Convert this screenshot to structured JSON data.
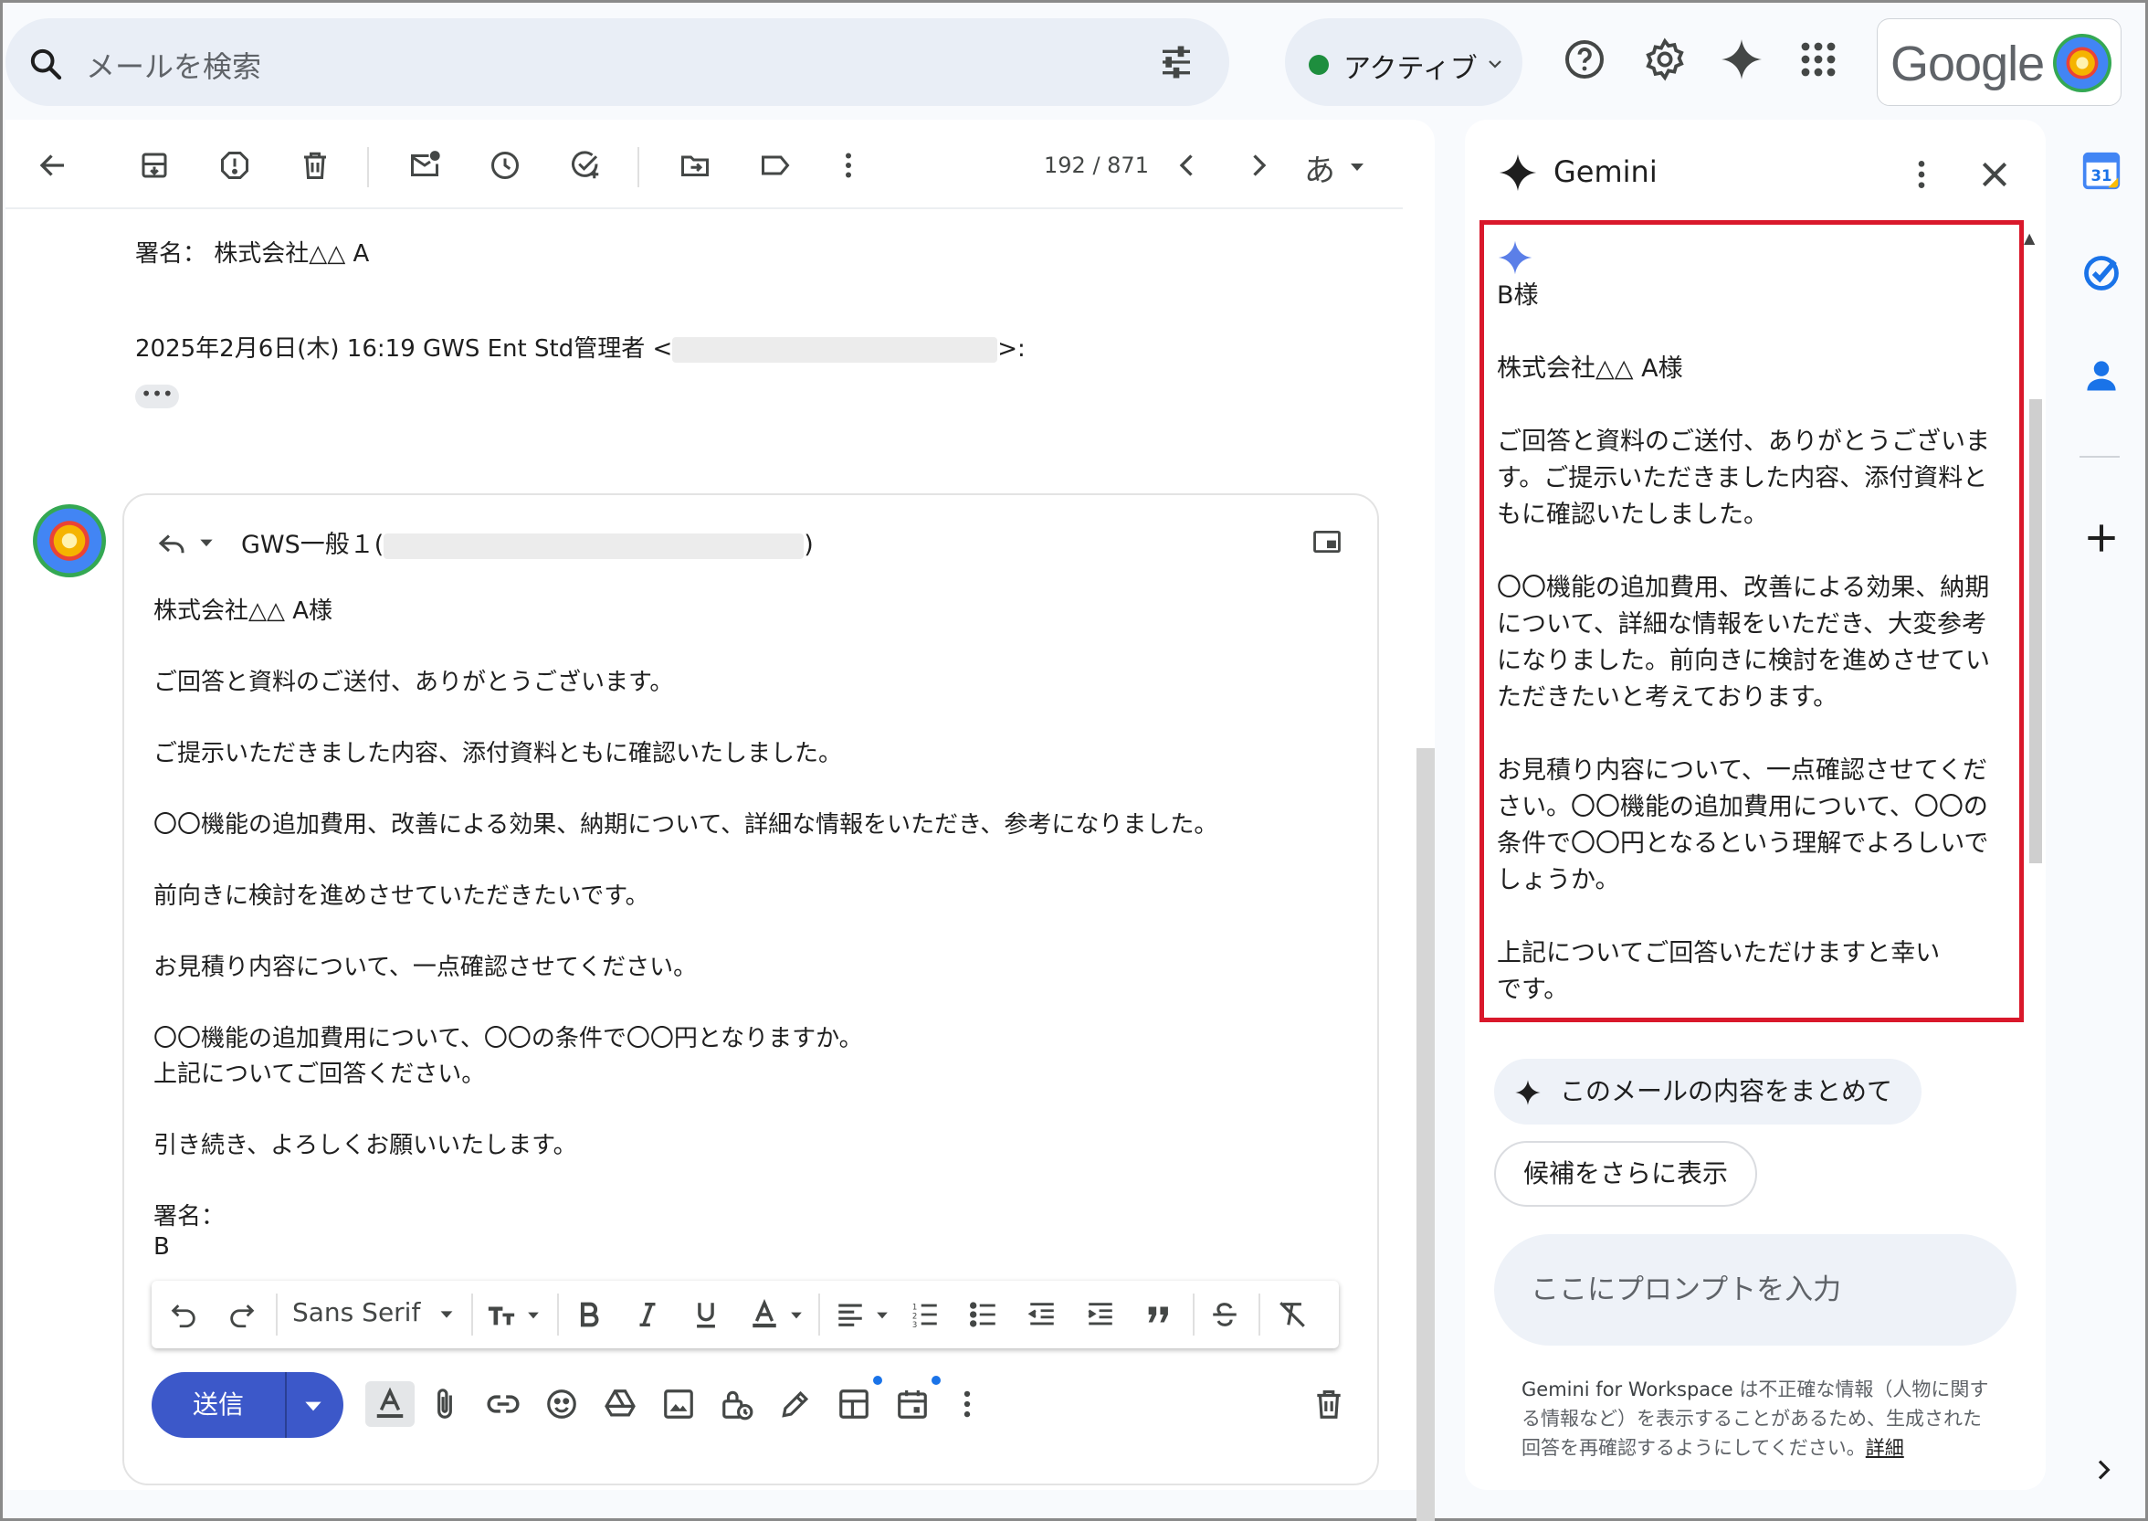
{
  "topbar": {
    "search_placeholder": "メールを検索",
    "status_label": "アクティブ",
    "google_wordmark": "Google"
  },
  "toolbar": {
    "pager": "192 / 871",
    "language": "あ"
  },
  "quoted": {
    "signature": "署名： 株式会社△△ A",
    "header_line_prefix": "2025年2月6日(木) 16:19 GWS Ent Std管理者 <",
    "header_line_suffix": ">:",
    "more": "•••"
  },
  "compose": {
    "to_prefix": "GWS一般１(",
    "to_suffix": ")",
    "body": [
      "株式会社△△ A様",
      "ご回答と資料のご送付、ありがとうございます。",
      "ご提示いただきました内容、添付資料ともに確認いたしました。",
      "〇〇機能の追加費用、改善による効果、納期について、詳細な情報をいただき、参考になりました。",
      "前向きに検討を進めさせていただきたいです。",
      "お見積り内容について、一点確認させてください。",
      "〇〇機能の追加費用について、〇〇の条件で〇〇円となりますか。",
      "上記についてご回答ください。",
      "引き続き、よろしくお願いいたします。",
      "署名：",
      "B"
    ],
    "font_name": "Sans Serif",
    "send_label": "送信"
  },
  "gemini": {
    "title": "Gemini",
    "response_lines": [
      "B様",
      "株式会社△△ A様",
      "ご回答と資料のご送付、ありがとうございま",
      "す。ご提示いただきました内容、添付資料と",
      "もに確認いたしました。",
      "〇〇機能の追加費用、改善による効果、納期",
      "について、詳細な情報をいただき、大変参考",
      "になりました。前向きに検討を進めさせてい",
      "ただきたいと考えております。",
      "お見積り内容について、一点確認させてくだ",
      "さい。〇〇機能の追加費用について、〇〇の",
      "条件で〇〇円となるという理解でよろしいで",
      "しょうか。",
      "上記についてご回答いただけますと幸い",
      "です。"
    ],
    "chip_summary": "このメールの内容をまとめて",
    "chip_more": "候補をさらに表示",
    "prompt_placeholder": "ここにプロンプトを入力",
    "disclaimer_brand": "Gemini for Workspace",
    "disclaimer_text": " は不正確な情報（人物に関する情報など）を表示することがあるため、生成された回答を再確認するようにしてください。",
    "disclaimer_link": "詳細"
  },
  "rail": {
    "calendar_day": "31"
  },
  "colors": {
    "send_button": "#3c58c9",
    "highlight_border": "#d9182b",
    "status_green": "#1e8e3e",
    "gemini_spark": "#5b7fe8"
  }
}
